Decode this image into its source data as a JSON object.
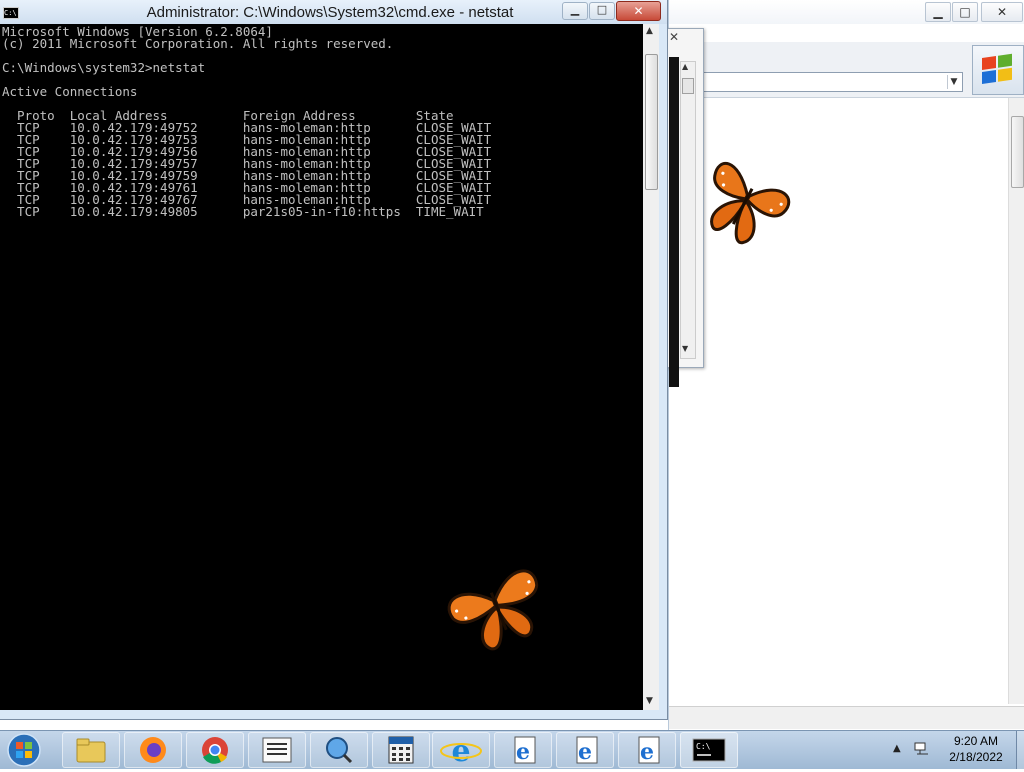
{
  "cmd_window": {
    "title": "Administrator: C:\\Windows\\System32\\cmd.exe - netstat",
    "icon_text": "C:\\",
    "min_glyph": "▁",
    "max_glyph": "□",
    "close_glyph": "✕",
    "console_lines": [
      "Microsoft Windows [Version 6.2.8064]",
      "(c) 2011 Microsoft Corporation. All rights reserved.",
      "",
      "C:\\Windows\\system32>netstat",
      "",
      "Active Connections",
      "",
      "  Proto  Local Address          Foreign Address        State",
      "  TCP    10.0.42.179:49752      hans-moleman:http      CLOSE_WAIT",
      "  TCP    10.0.42.179:49753      hans-moleman:http      CLOSE_WAIT",
      "  TCP    10.0.42.179:49756      hans-moleman:http      CLOSE_WAIT",
      "  TCP    10.0.42.179:49757      hans-moleman:http      CLOSE_WAIT",
      "  TCP    10.0.42.179:49759      hans-moleman:http      CLOSE_WAIT",
      "  TCP    10.0.42.179:49761      hans-moleman:http      CLOSE_WAIT",
      "  TCP    10.0.42.179:49767      hans-moleman:http      CLOSE_WAIT",
      "  TCP    10.0.42.179:49805      par21s05-in-f10:https  TIME_WAIT"
    ]
  },
  "background_window": {
    "min_glyph": "▁",
    "max_glyph": "□",
    "close_glyph": "✕",
    "dropdown_glyph": "▼"
  },
  "popup": {
    "close_glyph": "✕",
    "up_glyph": "▲",
    "down_glyph": "▼"
  },
  "taskbar": {
    "pinned": [
      {
        "name": "file-explorer-icon"
      },
      {
        "name": "firefox-icon"
      },
      {
        "name": "chrome-icon"
      },
      {
        "name": "task-list-icon"
      },
      {
        "name": "magnifier-globe-icon"
      },
      {
        "name": "calculator-app-icon"
      },
      {
        "name": "internet-explorer-icon"
      },
      {
        "name": "ie-document-icon"
      },
      {
        "name": "ie-document-icon"
      },
      {
        "name": "ie-document-icon"
      },
      {
        "name": "command-prompt-icon"
      }
    ],
    "tray_arrow": "▲",
    "clock_time": "9:20 AM",
    "clock_date": "2/18/2022"
  }
}
